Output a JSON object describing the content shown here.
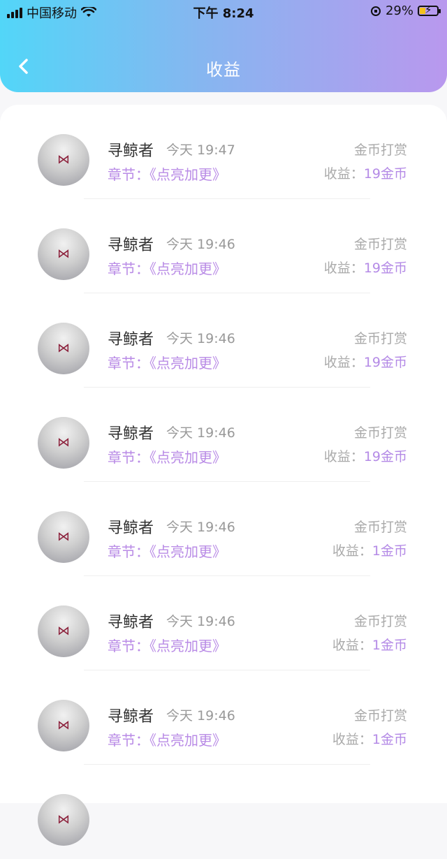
{
  "status": {
    "carrier": "中国移动",
    "time": "下午 8:24",
    "battery": "29%",
    "battery_level": 0.29
  },
  "nav": {
    "title": "收益"
  },
  "records": [
    {
      "name": "寻鲸者",
      "time": "今天 19:47",
      "chapter_prefix": "章节：",
      "chapter": "《点亮加更》",
      "type": "金币打赏",
      "income_label": "收益：",
      "income_amount": "19金币"
    },
    {
      "name": "寻鲸者",
      "time": "今天 19:46",
      "chapter_prefix": "章节：",
      "chapter": "《点亮加更》",
      "type": "金币打赏",
      "income_label": "收益：",
      "income_amount": "19金币"
    },
    {
      "name": "寻鲸者",
      "time": "今天 19:46",
      "chapter_prefix": "章节：",
      "chapter": "《点亮加更》",
      "type": "金币打赏",
      "income_label": "收益：",
      "income_amount": "19金币"
    },
    {
      "name": "寻鲸者",
      "time": "今天 19:46",
      "chapter_prefix": "章节：",
      "chapter": "《点亮加更》",
      "type": "金币打赏",
      "income_label": "收益：",
      "income_amount": "19金币"
    },
    {
      "name": "寻鲸者",
      "time": "今天 19:46",
      "chapter_prefix": "章节：",
      "chapter": "《点亮加更》",
      "type": "金币打赏",
      "income_label": "收益：",
      "income_amount": "1金币"
    },
    {
      "name": "寻鲸者",
      "time": "今天 19:46",
      "chapter_prefix": "章节：",
      "chapter": "《点亮加更》",
      "type": "金币打赏",
      "income_label": "收益：",
      "income_amount": "1金币"
    },
    {
      "name": "寻鲸者",
      "time": "今天 19:46",
      "chapter_prefix": "章节：",
      "chapter": "《点亮加更》",
      "type": "金币打赏",
      "income_label": "收益：",
      "income_amount": "1金币"
    }
  ],
  "colors": {
    "header_gradient_start": "#52d6f8",
    "header_gradient_end": "#b998ee",
    "accent_purple": "#b98be6"
  }
}
